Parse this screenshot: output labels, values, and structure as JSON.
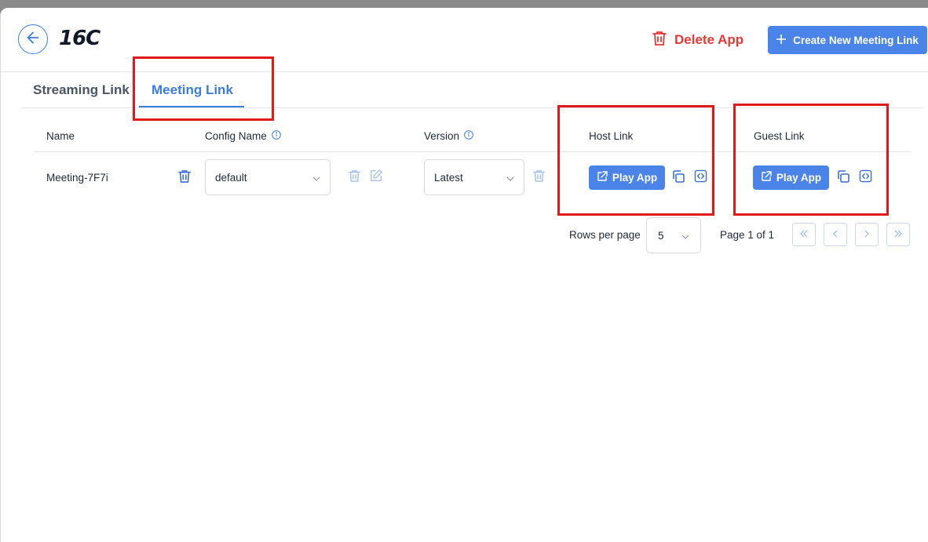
{
  "app": {
    "title": "16C"
  },
  "header": {
    "delete_label": "Delete App",
    "create_label": "Create New Meeting Link"
  },
  "tabs": [
    {
      "label": "Streaming Link"
    },
    {
      "label": "Meeting Link",
      "active": true
    }
  ],
  "table": {
    "columns": {
      "name": "Name",
      "config": "Config Name",
      "version": "Version",
      "host": "Host Link",
      "guest": "Guest Link"
    },
    "rows": [
      {
        "name": "Meeting-7F7i",
        "config": "default",
        "version": "Latest",
        "host_button": "Play App",
        "guest_button": "Play App"
      }
    ]
  },
  "pagination": {
    "rows_label": "Rows per page",
    "rows_value": "5",
    "page_text": "Page 1 of 1"
  },
  "colors": {
    "accent": "#4a84e8",
    "danger": "#e53935",
    "annotation": "#e01a1a"
  }
}
